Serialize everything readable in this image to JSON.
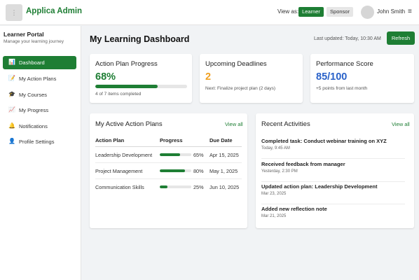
{
  "header": {
    "logo_icon": "⋮",
    "app_title": "Applica Admin",
    "view_as_label": "View as:",
    "roles": [
      {
        "label": "Learner",
        "active": true
      },
      {
        "label": "Sponsor",
        "active": false
      }
    ],
    "user_name": "John Smith",
    "menu_icon": "≡"
  },
  "sidebar": {
    "title": "Learner Portal",
    "subtitle": "Manage your learning journey",
    "items": [
      {
        "label": "Dashboard",
        "icon": "📊",
        "active": true
      },
      {
        "label": "My Action Plans",
        "icon": "📝",
        "active": false
      },
      {
        "label": "My Courses",
        "icon": "🎓",
        "active": false
      },
      {
        "label": "My Progress",
        "icon": "📈",
        "active": false
      },
      {
        "label": "Notifications",
        "icon": "🔔",
        "active": false
      },
      {
        "label": "Profile Settings",
        "icon": "👤",
        "active": false
      }
    ]
  },
  "main": {
    "title": "My Learning Dashboard",
    "last_updated": "Last updated: Today, 10:30 AM",
    "refresh_label": "Refresh",
    "stats": {
      "action_plan": {
        "title": "Action Plan Progress",
        "value": "68%",
        "progress_pct": 68,
        "subtitle": "4 of 7 items completed"
      },
      "deadlines": {
        "title": "Upcoming Deadlines",
        "value": "2",
        "subtitle": "Next: Finalize project plan (2 days)"
      },
      "performance": {
        "title": "Performance Score",
        "value": "85/100",
        "subtitle": "+5 points from last month"
      }
    },
    "plans": {
      "title": "My Active Action Plans",
      "view_all": "View all",
      "columns": [
        "Action Plan",
        "Progress",
        "Due Date"
      ],
      "rows": [
        {
          "name": "Leadership Development",
          "progress": 65,
          "progress_label": "65%",
          "due": "Apr 15, 2025"
        },
        {
          "name": "Project Management",
          "progress": 80,
          "progress_label": "80%",
          "due": "May 1, 2025"
        },
        {
          "name": "Communication Skills",
          "progress": 25,
          "progress_label": "25%",
          "due": "Jun 10, 2025"
        }
      ]
    },
    "activities": {
      "title": "Recent Activities",
      "view_all": "View all",
      "items": [
        {
          "title": "Completed task: Conduct webinar training on XYZ",
          "time": "Today, 9:45 AM"
        },
        {
          "title": "Received feedback from manager",
          "time": "Yesterday, 2:30 PM"
        },
        {
          "title": "Updated action plan: Leadership Development",
          "time": "Mar 23, 2025"
        },
        {
          "title": "Added new reflection note",
          "time": "Mar 21, 2025"
        }
      ]
    }
  },
  "colors": {
    "accent": "#1e7e34",
    "deadline_value": "#f0a020",
    "performance_value": "#2a62c9"
  }
}
